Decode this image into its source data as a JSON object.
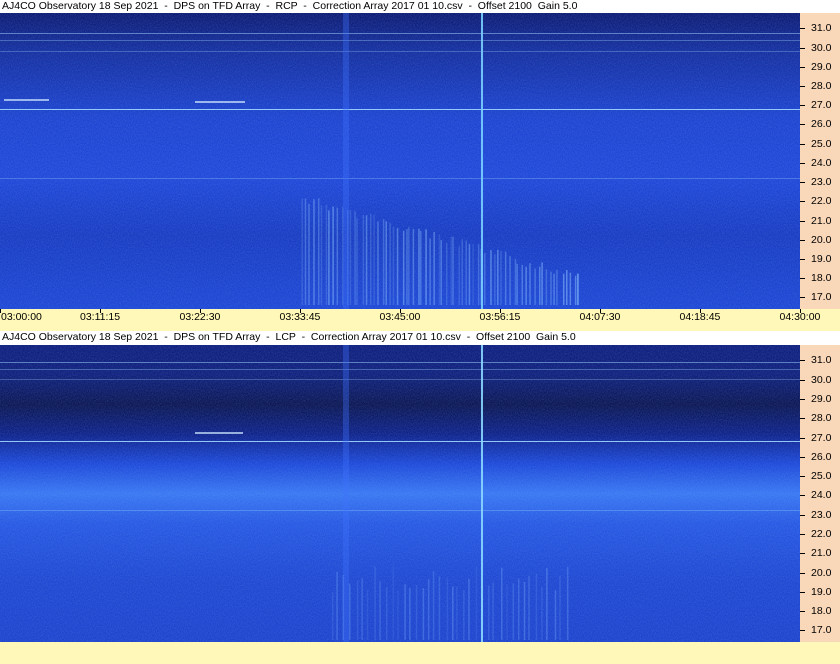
{
  "colors": {
    "spectrogram_base": "#1a3ad0",
    "spectrogram_dark": "#08166a",
    "spectrogram_bright": "#6fb8ff",
    "freq_axis_bg": "#f9d7b9",
    "time_axis_bg": "#fff8b8"
  },
  "chart_data": [
    {
      "type": "heatmap",
      "title": "AJ4CO Observatory 18 Sep 2021  -  DPS on TFD Array  -  RCP  -  Correction Array 2017 01 10.csv  -  Offset 2100  Gain 5.0",
      "y_ticks": [
        "31.0",
        "30.0",
        "29.0",
        "28.0",
        "27.0",
        "26.0",
        "25.0",
        "24.0",
        "23.0",
        "22.0",
        "21.0",
        "20.0",
        "19.0",
        "18.0",
        "17.0"
      ],
      "ylim": [
        16.4,
        31.8
      ],
      "x_ticks": [
        "03:00:00",
        "03:11:15",
        "03:22:30",
        "03:33:45",
        "03:45:00",
        "03:56:15",
        "04:07:30",
        "04:18:45",
        "04:30:00"
      ],
      "xlim": [
        "03:00:00",
        "04:30:00"
      ]
    },
    {
      "type": "heatmap",
      "title": "AJ4CO Observatory 18 Sep 2021  -  DPS on TFD Array  -  LCP  -  Correction Array 2017 01 10.csv  -  Offset 2100  Gain 5.0",
      "y_ticks": [
        "31.0",
        "30.0",
        "29.0",
        "28.0",
        "27.0",
        "26.0",
        "25.0",
        "24.0",
        "23.0",
        "22.0",
        "21.0",
        "20.0",
        "19.0",
        "18.0",
        "17.0"
      ],
      "ylim": [
        16.4,
        31.8
      ]
    }
  ]
}
